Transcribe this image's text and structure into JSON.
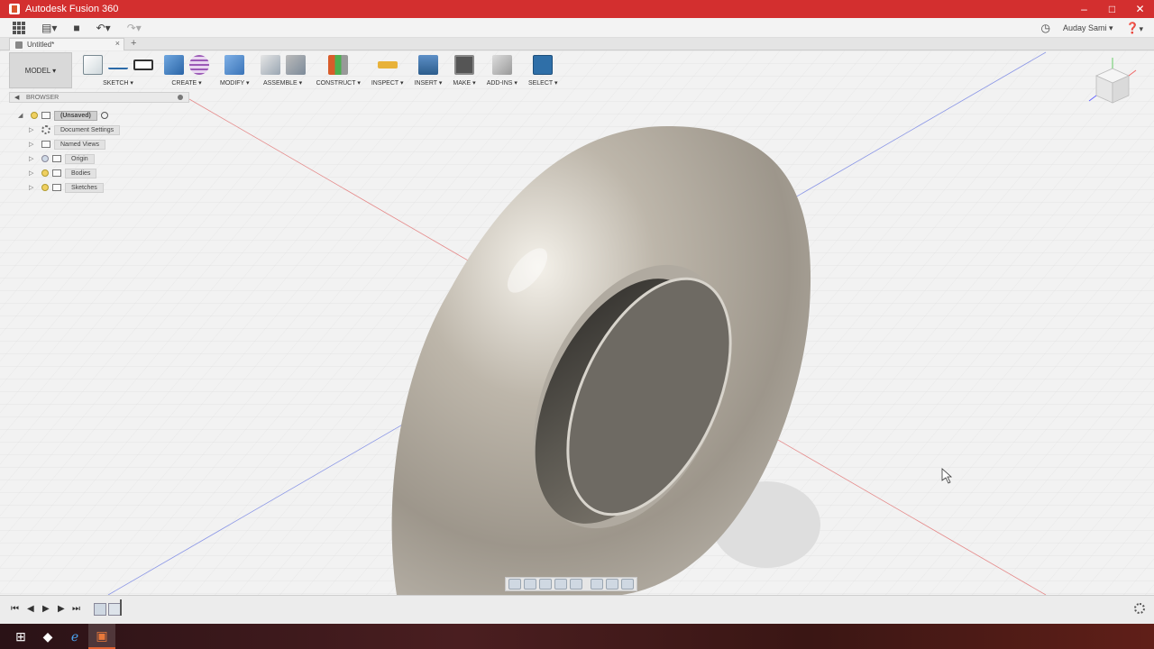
{
  "window": {
    "title": "Autodesk Fusion 360",
    "controls": [
      "–",
      "□",
      "✕"
    ]
  },
  "quick_access": {
    "user_name": "Auday Sami",
    "user_caret": "▾",
    "help_caret": "▾"
  },
  "tabs": {
    "doc_title": "Untitled*",
    "close": "×",
    "add": "+"
  },
  "toolbar": {
    "workspace": "MODEL ▾",
    "groups": {
      "sketch": "SKETCH ▾",
      "create": "CREATE ▾",
      "modify": "MODIFY ▾",
      "assemble": "ASSEMBLE ▾",
      "construct": "CONSTRUCT ▾",
      "inspect": "INSPECT ▾",
      "insert": "INSERT ▾",
      "make": "MAKE ▾",
      "addins": "ADD-INS ▾",
      "select": "SELECT ▾"
    }
  },
  "browser": {
    "title": "BROWSER",
    "root": "(Unsaved)",
    "items": [
      "Document Settings",
      "Named Views",
      "Origin",
      "Bodies",
      "Sketches"
    ]
  },
  "timeline": {
    "controls": [
      "⏮",
      "◀",
      "▶",
      "⏭"
    ]
  },
  "colors": {
    "titlebar": "#d32f2f",
    "select_active": "#2f6fa8",
    "x_axis": "#e05a5a",
    "z_axis": "#5a6ee0"
  }
}
